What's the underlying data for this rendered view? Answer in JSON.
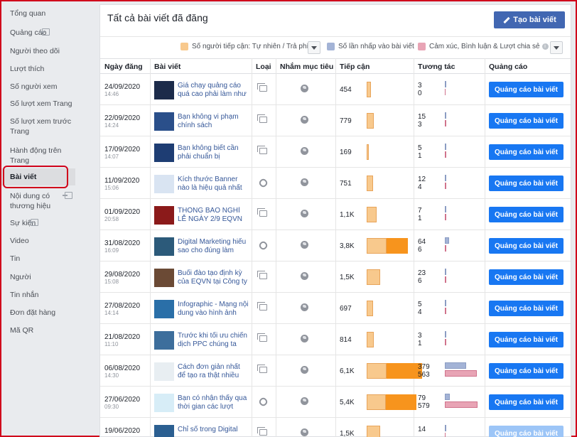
{
  "sidebar": {
    "items": [
      {
        "label": "Tổng quan"
      },
      {
        "label": "Quảng cáo",
        "external": true
      },
      {
        "label": "Người theo dõi"
      },
      {
        "label": "Lượt thích"
      },
      {
        "label": "Số người xem"
      },
      {
        "label": "Số lượt xem Trang"
      },
      {
        "label": "Số lượt xem trước Trang"
      },
      {
        "label": "Hành động trên Trang"
      },
      {
        "label": "Bài viết",
        "active": true
      },
      {
        "label": "Nội dung có thương hiệu",
        "external": true
      },
      {
        "label": "Sự kiện",
        "external": true
      },
      {
        "label": "Video"
      },
      {
        "label": "Tin"
      },
      {
        "label": "Người"
      },
      {
        "label": "Tin nhắn"
      },
      {
        "label": "Đơn đặt hàng"
      },
      {
        "label": "Mã QR"
      }
    ]
  },
  "main": {
    "title": "Tất cả bài viết đã đăng",
    "create_button": "Tạo bài viết",
    "legend": {
      "reach": "Số người tiếp cận: Tự nhiên / Trả phí",
      "clicks": "Số lần nhấp vào bài viết",
      "reactions": "Cảm xúc, Bình luận & Lượt chia sẻ"
    },
    "colors": {
      "reach_organic": "#f8c98d",
      "reach_paid": "#f7941d",
      "clicks": "#a3b3d6",
      "reactions": "#e8a4b5",
      "button": "#1877f2"
    },
    "columns": [
      "Ngày đăng",
      "Bài viết",
      "Loại",
      "Nhắm mục tiêu",
      "Tiếp cận",
      "Tương tác",
      "Quảng cáo"
    ]
  },
  "rows": [
    {
      "date": "24/09/2020",
      "time": "14:46",
      "title": "Giá chạy quảng cáo quá cao phải làm như",
      "type": "album",
      "reach": "454",
      "reach_org": 0.06,
      "reach_paid": 0,
      "clicks": "3",
      "reactions": "0",
      "click_frac": 0.02,
      "react_frac": 0,
      "ad": "Quảng cáo bài viết",
      "thumb": "#1c2b4a"
    },
    {
      "date": "22/09/2020",
      "time": "14:24",
      "title": "Bạn không vi phạm chính sách",
      "type": "album",
      "reach": "779",
      "reach_org": 0.1,
      "reach_paid": 0,
      "clicks": "15",
      "reactions": "3",
      "click_frac": 0.03,
      "react_frac": 0.01,
      "ad": "Quảng cáo bài viết",
      "thumb": "#2a4f8a"
    },
    {
      "date": "17/09/2020",
      "time": "14:07",
      "title": "Bạn không biết cần phải chuẩn bị",
      "type": "album",
      "reach": "169",
      "reach_org": 0.02,
      "reach_paid": 0,
      "clicks": "5",
      "reactions": "1",
      "click_frac": 0.02,
      "react_frac": 0.01,
      "ad": "Quảng cáo bài viết",
      "thumb": "#1e3d73"
    },
    {
      "date": "11/09/2020",
      "time": "15:06",
      "title": "Kích thước Banner nào là hiệu quả nhất",
      "type": "link",
      "reach": "751",
      "reach_org": 0.09,
      "reach_paid": 0,
      "clicks": "12",
      "reactions": "4",
      "click_frac": 0.03,
      "react_frac": 0.01,
      "ad": "Quảng cáo bài viết",
      "thumb": "#d9e4f2"
    },
    {
      "date": "01/09/2020",
      "time": "20:58",
      "title": "THÔNG BÁO NGHỈ LỄ NGÀY 2/9 EQVN",
      "type": "album",
      "reach": "1,1K",
      "reach_org": 0.14,
      "reach_paid": 0,
      "clicks": "7",
      "reactions": "1",
      "click_frac": 0.02,
      "react_frac": 0.01,
      "ad": "Quảng cáo bài viết",
      "thumb": "#8b1a1a"
    },
    {
      "date": "31/08/2020",
      "time": "16:09",
      "title": "Digital Marketing hiểu sao cho đúng làm",
      "type": "link",
      "reach": "3,8K",
      "reach_org": 0.28,
      "reach_paid": 0.3,
      "clicks": "64",
      "reactions": "6",
      "click_frac": 0.1,
      "react_frac": 0.01,
      "ad": "Quảng cáo bài viết",
      "thumb": "#2c5a7a"
    },
    {
      "date": "29/08/2020",
      "time": "15:08",
      "title": "Buổi đào tạo định kỳ của EQVN tại Công ty",
      "type": "album",
      "reach": "1,5K",
      "reach_org": 0.19,
      "reach_paid": 0,
      "clicks": "23",
      "reactions": "6",
      "click_frac": 0.04,
      "react_frac": 0.01,
      "ad": "Quảng cáo bài viết",
      "thumb": "#6b4a35"
    },
    {
      "date": "27/08/2020",
      "time": "14:14",
      "title": "Infographic - Mạng nội dung vào hình ảnh",
      "type": "album",
      "reach": "697",
      "reach_org": 0.09,
      "reach_paid": 0,
      "clicks": "5",
      "reactions": "4",
      "click_frac": 0.02,
      "react_frac": 0.01,
      "ad": "Quảng cáo bài viết",
      "thumb": "#2a6fa8"
    },
    {
      "date": "21/08/2020",
      "time": "11:10",
      "title": "Trước khi tối ưu chiến dịch PPC chúng ta",
      "type": "album",
      "reach": "814",
      "reach_org": 0.1,
      "reach_paid": 0,
      "clicks": "3",
      "reactions": "1",
      "click_frac": 0.02,
      "react_frac": 0.01,
      "ad": "Quảng cáo bài viết",
      "thumb": "#3d6e9c"
    },
    {
      "date": "06/08/2020",
      "time": "14:30",
      "title": "Cách đơn giản nhất để tạo ra thật nhiều",
      "type": "album",
      "reach": "6,1K",
      "reach_org": 0.28,
      "reach_paid": 0.5,
      "clicks": "379",
      "reactions": "563",
      "click_frac": 0.5,
      "react_frac": 0.75,
      "ad": "Quảng cáo bài viết",
      "thumb": "#e8eef2"
    },
    {
      "date": "27/06/2020",
      "time": "09:30",
      "title": "Bạn có nhận thấy qua thời gian các lượt",
      "type": "link",
      "reach": "5,4K",
      "reach_org": 0.27,
      "reach_paid": 0.43,
      "clicks": "79",
      "reactions": "579",
      "click_frac": 0.11,
      "react_frac": 0.77,
      "ad": "Quảng cáo bài viết",
      "thumb": "#d7edf7"
    },
    {
      "date": "19/06/2020",
      "time": "",
      "title": "Chỉ số trong Digital",
      "type": "album",
      "reach": "1,5K",
      "reach_org": 0.19,
      "reach_paid": 0,
      "clicks": "14",
      "reactions": "",
      "click_frac": 0.03,
      "react_frac": 0,
      "ad": "Quảng cáo bài viết",
      "faded": true,
      "thumb": "#2b5f91"
    }
  ]
}
